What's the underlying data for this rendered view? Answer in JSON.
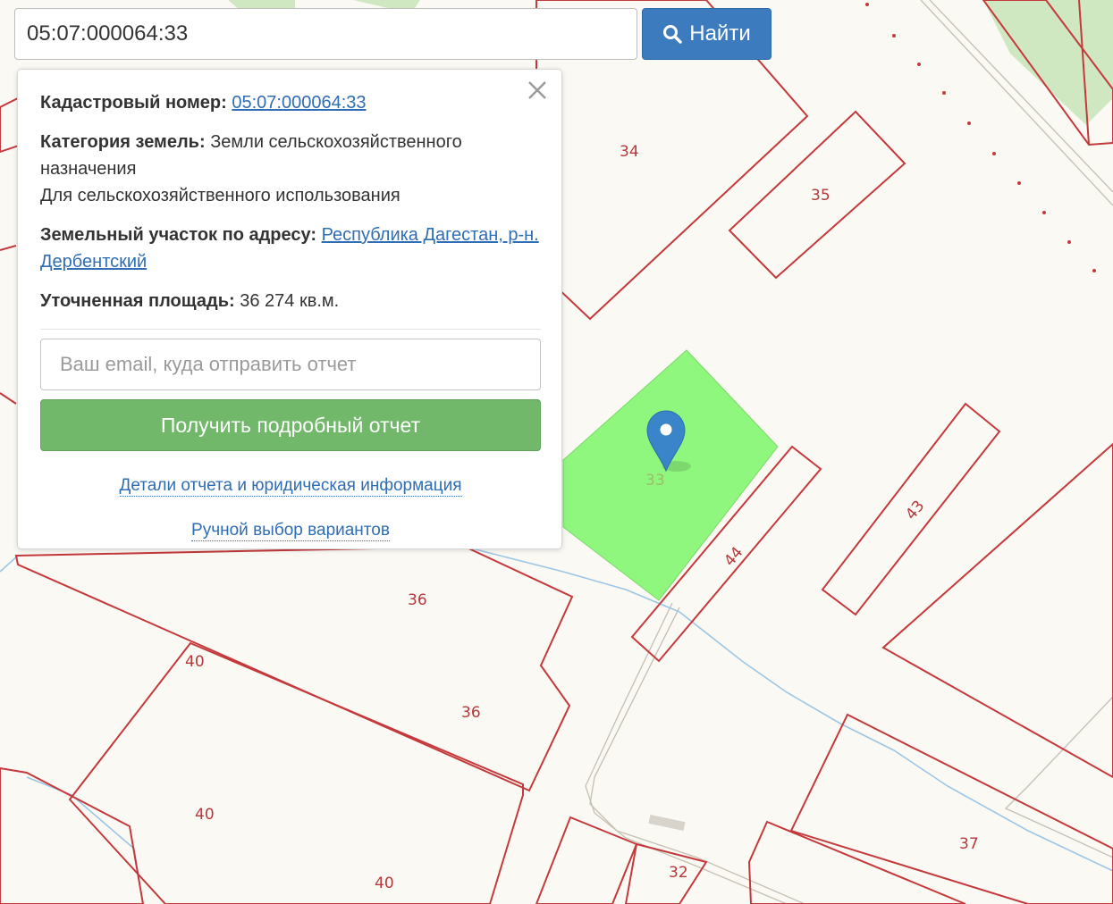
{
  "search": {
    "query": "05:07:000064:33",
    "button_label": "Найти"
  },
  "popup": {
    "cadastral_label": "Кадастровый номер:",
    "cadastral_number": "05:07:000064:33",
    "category_label": "Категория земель:",
    "category_value": "Земли сельскохозяйственного назначения",
    "usage": "Для сельскохозяйственного использования",
    "address_label": "Земельный участок по адресу:",
    "address_value": "Республика Дагестан, р-н. Дербентский",
    "area_label": "Уточненная площадь:",
    "area_value": "36 274 кв.м.",
    "email_placeholder": "Ваш email, куда отправить отчет",
    "report_button": "Получить подробный отчет",
    "details_link": "Детали отчета и юридическая информация",
    "manual_link": "Ручной выбор вариантов"
  },
  "map": {
    "parcel_labels": {
      "p34": "34",
      "p35": "35",
      "p33": "33",
      "p44": "44",
      "p43": "43",
      "p36a": "36",
      "p36b": "36",
      "p40a": "40",
      "p40b": "40",
      "p40c": "40",
      "p37": "37",
      "p32": "32"
    },
    "colors": {
      "parcel_border": "#c4393b",
      "selected_fill": "#8ff77e",
      "marker": "#3a84c9",
      "background": "#fbf9f3",
      "forest": "#cfe8c2"
    }
  }
}
